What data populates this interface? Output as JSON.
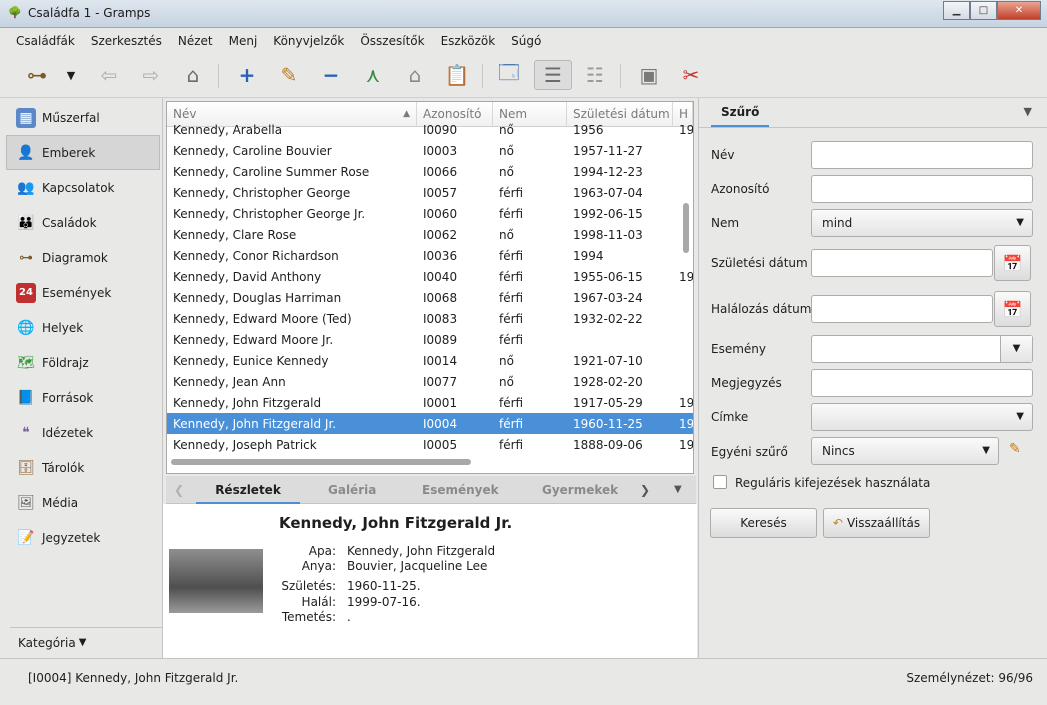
{
  "window": {
    "title": "Családfa 1 - Gramps"
  },
  "menu": [
    "Családfák",
    "Szerkesztés",
    "Nézet",
    "Menj",
    "Könyvjelzők",
    "Összesítők",
    "Eszközök",
    "Súgó"
  ],
  "sidebar": {
    "items": [
      {
        "label": "Műszerfal",
        "icon": "dashboard-icon"
      },
      {
        "label": "Emberek",
        "icon": "people-icon"
      },
      {
        "label": "Kapcsolatok",
        "icon": "relationships-icon"
      },
      {
        "label": "Családok",
        "icon": "families-icon"
      },
      {
        "label": "Diagramok",
        "icon": "charts-icon"
      },
      {
        "label": "Események",
        "icon": "events-icon"
      },
      {
        "label": "Helyek",
        "icon": "places-icon"
      },
      {
        "label": "Földrajz",
        "icon": "geography-icon"
      },
      {
        "label": "Források",
        "icon": "sources-icon"
      },
      {
        "label": "Idézetek",
        "icon": "citations-icon"
      },
      {
        "label": "Tárolók",
        "icon": "repositories-icon"
      },
      {
        "label": "Média",
        "icon": "media-icon"
      },
      {
        "label": "Jegyzetek",
        "icon": "notes-icon"
      }
    ],
    "category_label": "Kategória"
  },
  "table": {
    "columns": [
      "Név",
      "Azonosító",
      "Nem",
      "Születési dátum",
      "H"
    ],
    "rows": [
      {
        "name": "Kennedy, Arabella",
        "id": "I0090",
        "sex": "nő",
        "birth": "1956",
        "extra": "19"
      },
      {
        "name": "Kennedy, Caroline Bouvier",
        "id": "I0003",
        "sex": "nő",
        "birth": "1957-11-27",
        "extra": ""
      },
      {
        "name": "Kennedy, Caroline Summer Rose",
        "id": "I0066",
        "sex": "nő",
        "birth": "1994-12-23",
        "extra": ""
      },
      {
        "name": "Kennedy, Christopher George",
        "id": "I0057",
        "sex": "férfi",
        "birth": "1963-07-04",
        "extra": ""
      },
      {
        "name": "Kennedy, Christopher George Jr.",
        "id": "I0060",
        "sex": "férfi",
        "birth": "1992-06-15",
        "extra": ""
      },
      {
        "name": "Kennedy, Clare Rose",
        "id": "I0062",
        "sex": "nő",
        "birth": "1998-11-03",
        "extra": ""
      },
      {
        "name": "Kennedy, Conor Richardson",
        "id": "I0036",
        "sex": "férfi",
        "birth": "1994",
        "extra": ""
      },
      {
        "name": "Kennedy, David Anthony",
        "id": "I0040",
        "sex": "férfi",
        "birth": "1955-06-15",
        "extra": "19"
      },
      {
        "name": "Kennedy, Douglas Harriman",
        "id": "I0068",
        "sex": "férfi",
        "birth": "1967-03-24",
        "extra": ""
      },
      {
        "name": "Kennedy, Edward Moore (Ted)",
        "id": "I0083",
        "sex": "férfi",
        "birth": "1932-02-22",
        "extra": ""
      },
      {
        "name": "Kennedy, Edward Moore Jr.",
        "id": "I0089",
        "sex": "férfi",
        "birth": "",
        "extra": ""
      },
      {
        "name": "Kennedy, Eunice Kennedy",
        "id": "I0014",
        "sex": "nő",
        "birth": "1921-07-10",
        "extra": ""
      },
      {
        "name": "Kennedy, Jean Ann",
        "id": "I0077",
        "sex": "nő",
        "birth": "1928-02-20",
        "extra": ""
      },
      {
        "name": "Kennedy, John Fitzgerald",
        "id": "I0001",
        "sex": "férfi",
        "birth": "1917-05-29",
        "extra": "19"
      },
      {
        "name": "Kennedy, John Fitzgerald Jr.",
        "id": "I0004",
        "sex": "férfi",
        "birth": "1960-11-25",
        "extra": "19"
      },
      {
        "name": "Kennedy, Joseph Patrick",
        "id": "I0005",
        "sex": "férfi",
        "birth": "1888-09-06",
        "extra": "19"
      }
    ],
    "selected_index": 14
  },
  "bottom_tabs": [
    "Részletek",
    "Galéria",
    "Események",
    "Gyermekek"
  ],
  "details": {
    "name": "Kennedy, John Fitzgerald Jr.",
    "father_label": "Apa:",
    "father": "Kennedy, John Fitzgerald",
    "mother_label": "Anya:",
    "mother": "Bouvier, Jacqueline Lee",
    "birth_label": "Születés:",
    "birth": "1960-11-25.",
    "death_label": "Halál:",
    "death": "1999-07-16.",
    "burial_label": "Temetés:",
    "burial": "."
  },
  "filter": {
    "tab": "Szűrő",
    "name_label": "Név",
    "id_label": "Azonosító",
    "sex_label": "Nem",
    "sex_value": "mind",
    "birth_label": "Születési dátum",
    "death_label": "Halálozás dátuma",
    "event_label": "Esemény",
    "note_label": "Megjegyzés",
    "tag_label": "Címke",
    "custom_label": "Egyéni szűrő",
    "custom_value": "Nincs",
    "regex_label": "Reguláris kifejezések használata",
    "search_button": "Keresés",
    "reset_button": "Visszaállítás"
  },
  "status": {
    "left": "[I0004] Kennedy, John Fitzgerald Jr.",
    "right": "Személynézet: 96/96"
  }
}
